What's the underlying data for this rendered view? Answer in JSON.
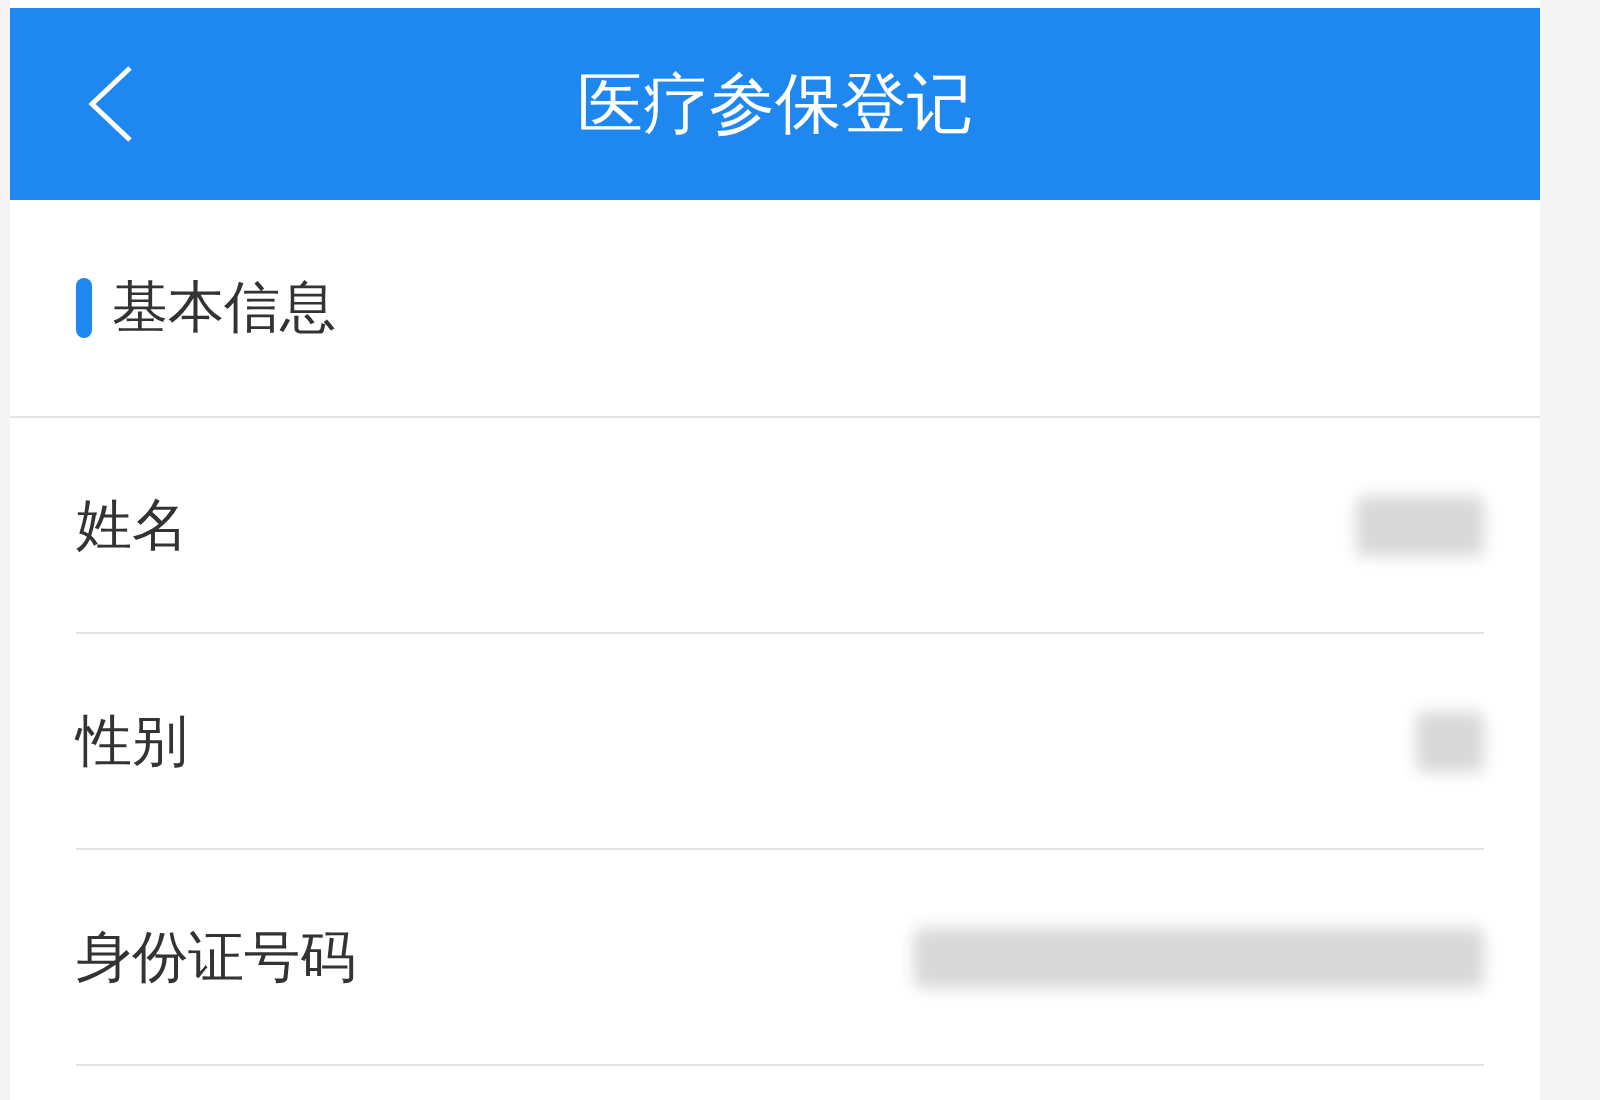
{
  "header": {
    "title": "医疗参保登记"
  },
  "section": {
    "title": "基本信息"
  },
  "fields": [
    {
      "label": "姓名",
      "kind": "blurred"
    },
    {
      "label": "性别",
      "kind": "blurred"
    },
    {
      "label": "身份证号码",
      "kind": "blurred"
    }
  ]
}
